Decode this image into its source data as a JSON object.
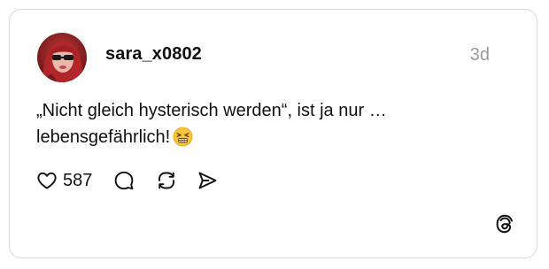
{
  "post": {
    "username": "sara_x0802",
    "timestamp": "3d",
    "text_line_1": "„Nicht gleich hysterisch werden“, ist ja nur …",
    "text_line_2": "lebensgefährlich!",
    "emoji": "persevering-face-emoji"
  },
  "actions": {
    "like_icon": "heart-icon",
    "like_count": "587",
    "comment_icon": "comment-bubble-icon",
    "repost_icon": "repost-icon",
    "share_icon": "send-icon"
  },
  "branding": {
    "logo": "threads-logo-icon"
  }
}
